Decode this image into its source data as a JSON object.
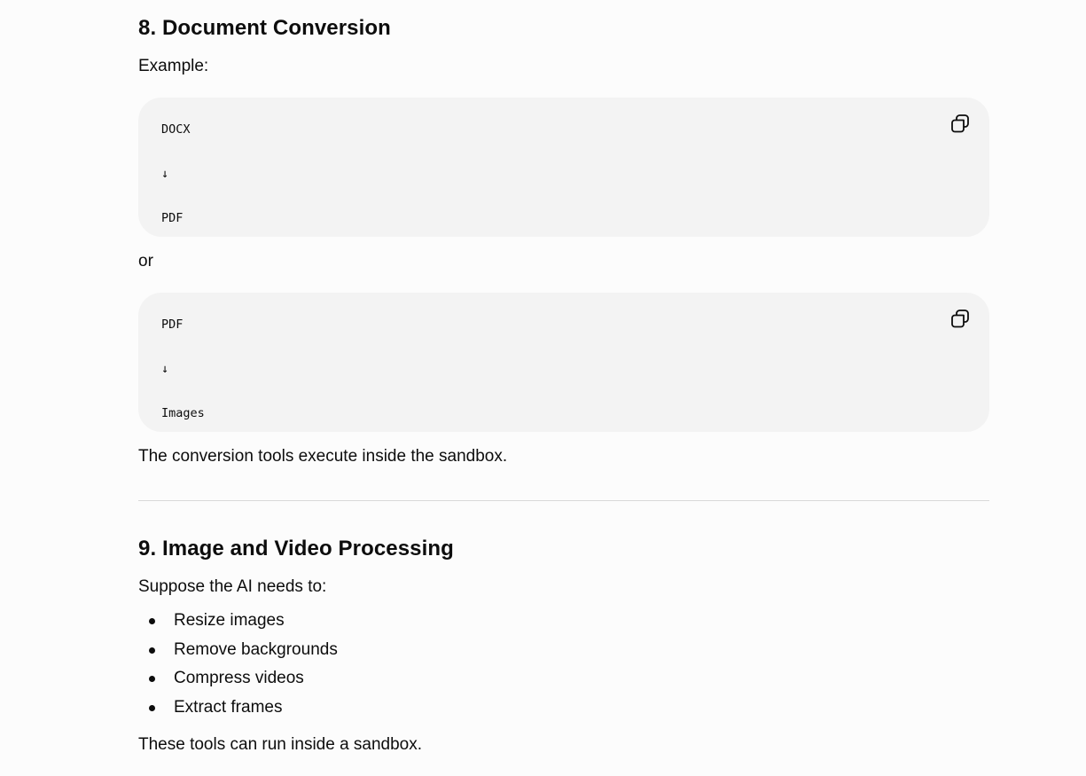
{
  "section8": {
    "heading": "8. Document Conversion",
    "intro": "Example:",
    "code_block_1": {
      "lines": [
        "DOCX",
        "↓",
        "PDF"
      ],
      "copy_icon": "copy-icon"
    },
    "connector": "or",
    "code_block_2": {
      "lines": [
        "PDF",
        "↓",
        "Images"
      ],
      "copy_icon": "copy-icon"
    },
    "conclusion": "The conversion tools execute inside the sandbox."
  },
  "section9": {
    "heading": "9. Image and Video Processing",
    "intro": "Suppose the AI needs to:",
    "items": [
      "Resize images",
      "Remove backgrounds",
      "Compress videos",
      "Extract frames"
    ],
    "conclusion": "These tools can run inside a sandbox."
  }
}
